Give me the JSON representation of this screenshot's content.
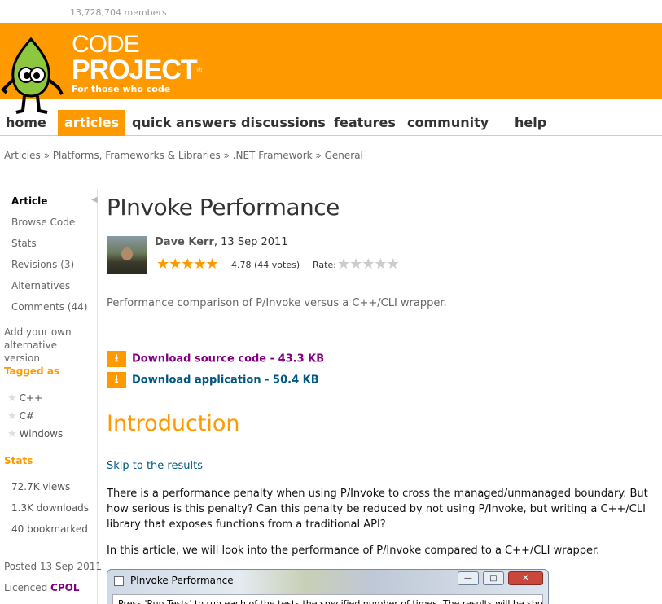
{
  "header": {
    "members": "13,728,704 members",
    "brand_line1": "CODE",
    "brand_line2": "PROJECT",
    "brand_reg": "®",
    "tagline": "For those who code",
    "brand_color": "#ff9900",
    "mascot_icon": "bob-mascot-icon"
  },
  "nav": {
    "items": [
      {
        "label": "home"
      },
      {
        "label": "articles",
        "active": true
      },
      {
        "label": "quick answers"
      },
      {
        "label": "discussions"
      },
      {
        "label": "features"
      },
      {
        "label": "community"
      },
      {
        "label": "help"
      }
    ]
  },
  "breadcrumb": "Articles » Platforms, Frameworks & Libraries » .NET Framework » General",
  "sidebar": {
    "links": [
      "Article",
      "Browse Code",
      "Stats",
      "Revisions (3)",
      "Alternatives",
      "Comments (44)"
    ],
    "add_alternative": "Add your own alternative version",
    "tagged_heading": "Tagged as",
    "tags": [
      "C++",
      "C#",
      "Windows"
    ],
    "stats_heading": "Stats",
    "stats": [
      "72.7K views",
      "1.3K downloads",
      "40 bookmarked"
    ],
    "posted": "Posted 13 Sep 2011",
    "licenced_label": "Licenced",
    "licence": "CPOL",
    "collapse_icon": "triangle-left-icon"
  },
  "article": {
    "title": "PInvoke Performance",
    "author": "Dave Kerr",
    "date": ", 13 Sep 2011",
    "stars": "★★★★★",
    "rating": "4.78 (44 votes)",
    "rate_label": "Rate:",
    "rate_stars": "★★★★★",
    "summary": "Performance comparison of P/Invoke versus a C++/CLI wrapper.",
    "downloads": [
      {
        "label": "Download source code - 43.3 KB"
      },
      {
        "label": "Download application - 50.4 KB"
      }
    ],
    "download_icon": "⭳",
    "intro_heading": "Introduction",
    "skip_link": "Skip to the results",
    "para1": "There is a performance penalty when using P/Invoke to cross the managed/unmanaged boundary. But how serious is this penalty? Can this penalty be reduced by not using P/Invoke, but writing a C++/CLI library that exposes functions from a traditional API?",
    "para2": "In this article, we will look into the performance of P/Invoke compared to a C++/CLI wrapper."
  },
  "window": {
    "title": "PInvoke Performance",
    "min": "—",
    "max": "□",
    "close": "✕",
    "body_text": "Press 'Run Tests' to run each of the tests the specified number of times. The results will be shown"
  }
}
